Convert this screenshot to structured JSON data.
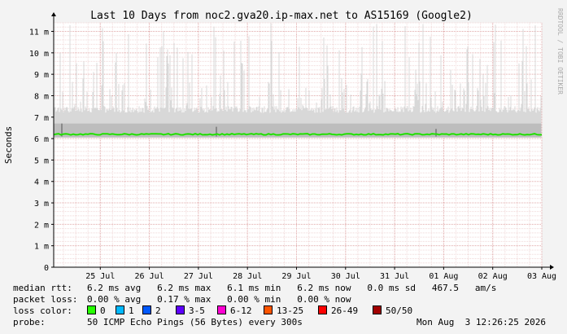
{
  "chart_data": {
    "type": "line",
    "title": "Last 10 Days from noc2.gva20.ip-max.net to AS15169 (Google2)",
    "ylabel": "Seconds",
    "watermark": "RRDTOOL / TOBI OETIKER",
    "ylim": [
      0,
      11.4
    ],
    "ytick_values": [
      0,
      1,
      2,
      3,
      4,
      5,
      6,
      7,
      8,
      9,
      10,
      11
    ],
    "ytick_labels": [
      "0",
      "1 m",
      "2 m",
      "3 m",
      "4 m",
      "5 m",
      "6 m",
      "7 m",
      "8 m",
      "9 m",
      "10 m",
      "11 m"
    ],
    "xtick_labels": [
      "25 Jul",
      "26 Jul",
      "27 Jul",
      "28 Jul",
      "29 Jul",
      "30 Jul",
      "31 Jul",
      "01 Aug",
      "02 Aug",
      "03 Aug"
    ],
    "x_start_day": 24.55,
    "x_end_day": 34.5,
    "series": [
      {
        "name": "median rtt",
        "unit": "ms",
        "avg": 6.2,
        "typical_spread_max": 7.2,
        "spike_max": 11.4
      }
    ]
  },
  "stats": {
    "median_rtt": {
      "label": "median rtt:",
      "text": "6.2 ms avg   6.2 ms max   6.1 ms min   6.2 ms now   0.0 ms sd   467.5   am/s"
    },
    "packet_loss": {
      "label": "packet loss:",
      "text": "0.00 % avg   0.17 % max   0.00 % min   0.00 % now"
    },
    "loss_color": {
      "label": "loss color:",
      "items": [
        {
          "label": "0",
          "color": "#26ff00"
        },
        {
          "label": "1",
          "color": "#00b8ff"
        },
        {
          "label": "2",
          "color": "#0059ff"
        },
        {
          "label": "3-5",
          "color": "#5e00ff"
        },
        {
          "label": "6-12",
          "color": "#ff00d2"
        },
        {
          "label": "13-25",
          "color": "#ff5500"
        },
        {
          "label": "26-49",
          "color": "#ff0000"
        },
        {
          "label": "50/50",
          "color": "#a10000"
        }
      ]
    },
    "probe": {
      "label": "probe:",
      "text": "50 ICMP Echo Pings (56 Bytes) every 300s"
    },
    "timestamp": "Mon Aug  3 12:26:25 2026"
  }
}
